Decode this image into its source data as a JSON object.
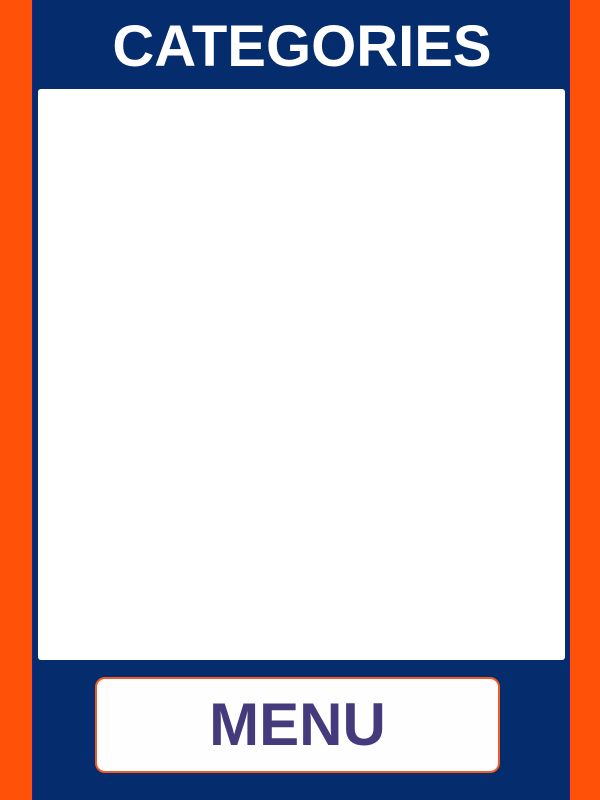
{
  "header": {
    "title": "CATEGORIES"
  },
  "footer": {
    "menu_label": "MENU"
  },
  "colors": {
    "side_bars": "#ff5208",
    "panel": "#052d6e",
    "content_background": "#ffffff",
    "menu_border": "#f25a26",
    "menu_text": "#453a7c"
  }
}
